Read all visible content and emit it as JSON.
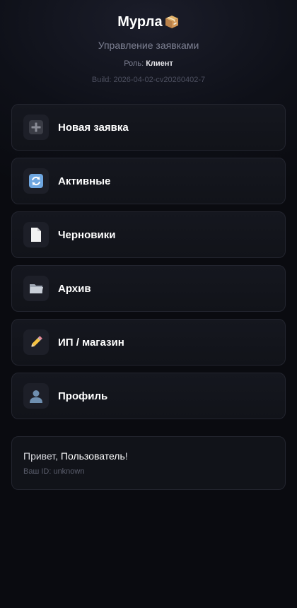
{
  "header": {
    "title": "Мурла",
    "title_icon": "package-icon",
    "subtitle": "Управление заявками",
    "role_label": "Роль:",
    "role_value": "Клиент",
    "build": "Build: 2026-04-02-cv20260402-7"
  },
  "menu": {
    "items": [
      {
        "label": "Новая заявка",
        "icon": "plus-icon"
      },
      {
        "label": "Активные",
        "icon": "refresh-icon"
      },
      {
        "label": "Черновики",
        "icon": "document-icon"
      },
      {
        "label": "Архив",
        "icon": "folder-icon"
      },
      {
        "label": "ИП / магазин",
        "icon": "pencil-icon"
      },
      {
        "label": "Профиль",
        "icon": "user-icon"
      }
    ]
  },
  "info": {
    "greeting_prefix": "Привет, ",
    "user_name": "Пользователь",
    "greeting_suffix": "!",
    "user_id": "Ваш ID: unknown"
  },
  "colors": {
    "background": "#0a0b10",
    "card": "#111319",
    "border": "#23252f",
    "muted_text": "#7e8193"
  }
}
